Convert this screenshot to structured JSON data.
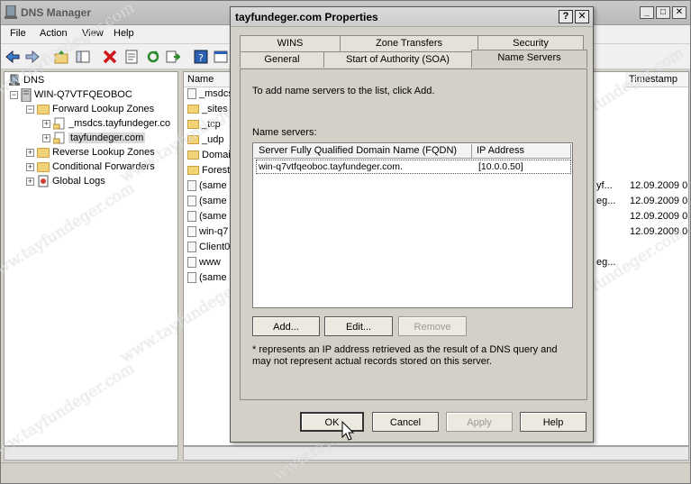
{
  "main": {
    "title": "DNS Manager",
    "menu": [
      "File",
      "Action",
      "View",
      "Help"
    ],
    "window_buttons": [
      "_",
      "□",
      "✕"
    ]
  },
  "tree": {
    "root": "DNS",
    "server": "WIN-Q7VTFQEOBOC",
    "forward": "Forward Lookup Zones",
    "msdcs": "_msdcs.tayfundeger.co",
    "zone": "tayfundeger.com",
    "reverse": "Reverse Lookup Zones",
    "conditional": "Conditional Forwarders",
    "global": "Global Logs",
    "expander_plus": "+",
    "expander_minus": "−"
  },
  "list": {
    "col_name": "Name",
    "col_timestamp": "Timestamp",
    "names": [
      "_msdcs",
      "_sites",
      "_tcp",
      "_udp",
      "Domain",
      "Forest",
      "(same",
      "(same",
      "(same",
      "win-q7",
      "Client0",
      "www",
      "(same"
    ],
    "data_fragments": [
      "yf...",
      "eg...",
      "eg..."
    ],
    "timestamps": [
      "12.09.2009 0",
      "12.09.2009 0",
      "12.09.2009 0",
      "12.09.2009 0"
    ]
  },
  "dialog": {
    "title": "tayfundeger.com Properties",
    "help_btn": "?",
    "close_btn": "✕",
    "tabs_row1": [
      "WINS",
      "Zone Transfers",
      "Security"
    ],
    "tabs_row2": [
      "General",
      "Start of Authority (SOA)",
      "Name Servers"
    ],
    "instruction": "To add name servers to the list, click Add.",
    "ns_label": "Name servers:",
    "col_fqdn": "Server Fully Qualified Domain Name (FQDN)",
    "col_ip": "IP Address",
    "rows": [
      {
        "fqdn": "win-q7vtfqeoboc.tayfundeger.com.",
        "ip": "[10.0.0.50]"
      }
    ],
    "btn_add": "Add...",
    "btn_edit": "Edit...",
    "btn_remove": "Remove",
    "footnote": "* represents an IP address retrieved as the result of a DNS query and may not represent actual records stored on this server.",
    "btn_ok": "OK",
    "btn_cancel": "Cancel",
    "btn_apply": "Apply",
    "btn_help": "Help"
  },
  "watermark": "www.tayfundeger.com"
}
